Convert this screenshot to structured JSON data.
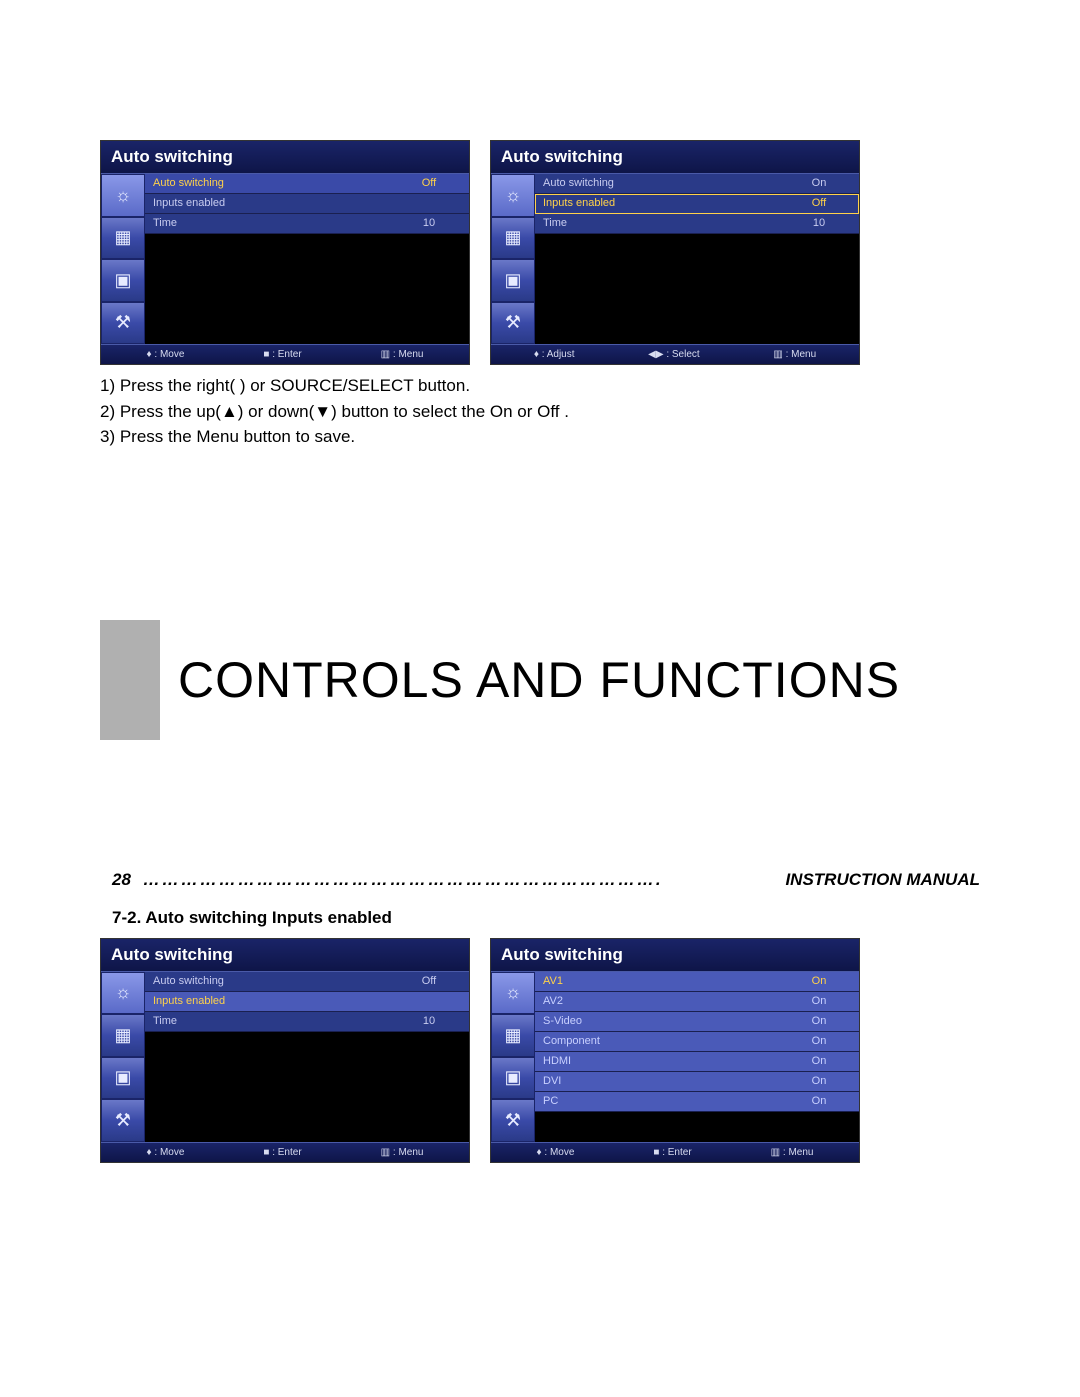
{
  "osd_title": "Auto switching",
  "panel1": {
    "rows": [
      {
        "label": "Auto switching",
        "value": "Off",
        "style": "selected"
      },
      {
        "label": "Inputs enabled",
        "value": "",
        "style": "plain"
      },
      {
        "label": "Time",
        "value": "10",
        "style": "plain"
      }
    ],
    "footer": {
      "a": "♦ : Move",
      "b": "■ : Enter",
      "c": "▥ : Menu"
    }
  },
  "panel2": {
    "rows": [
      {
        "label": "Auto switching",
        "value": "On",
        "style": "plain"
      },
      {
        "label": "Inputs enabled",
        "value": "Off",
        "style": "selected-yellow"
      },
      {
        "label": "Time",
        "value": "10",
        "style": "plain"
      }
    ],
    "footer": {
      "a": "♦ : Adjust",
      "b": "◀▶ : Select",
      "c": "▥ : Menu"
    }
  },
  "instructions": {
    "line1": "1) Press the right(  ) or SOURCE/SELECT button.",
    "line2": "2) Press the up(▲) or down(▼) button to select the On or Off .",
    "line3": "3) Press the Menu button to save."
  },
  "section_title": "Controls And Functions",
  "page_number": "28",
  "dots": "……………………………………………………………………….",
  "manual_label": "INSTRUCTION MANUAL",
  "subsection": "7-2. Auto switching Inputs enabled",
  "panel3": {
    "rows": [
      {
        "label": "Auto switching",
        "value": "Off",
        "style": "plain"
      },
      {
        "label": "Inputs enabled",
        "value": "",
        "style": "highlight-row"
      },
      {
        "label": "Time",
        "value": "10",
        "style": "plain"
      }
    ],
    "footer": {
      "a": "♦ : Move",
      "b": "■ : Enter",
      "c": "▥ : Menu"
    }
  },
  "panel4": {
    "rows": [
      {
        "label": "AV1",
        "value": "On",
        "style": "input-row sel"
      },
      {
        "label": "AV2",
        "value": "On",
        "style": "input-row"
      },
      {
        "label": "S-Video",
        "value": "On",
        "style": "input-row"
      },
      {
        "label": "Component",
        "value": "On",
        "style": "input-row"
      },
      {
        "label": "HDMI",
        "value": "On",
        "style": "input-row"
      },
      {
        "label": "DVI",
        "value": "On",
        "style": "input-row"
      },
      {
        "label": "PC",
        "value": "On",
        "style": "input-row"
      }
    ],
    "footer": {
      "a": "♦ : Move",
      "b": "■ : Enter",
      "c": "▥ : Menu"
    }
  },
  "side_icons": [
    "☼",
    "▦",
    "▣",
    "⚒"
  ]
}
